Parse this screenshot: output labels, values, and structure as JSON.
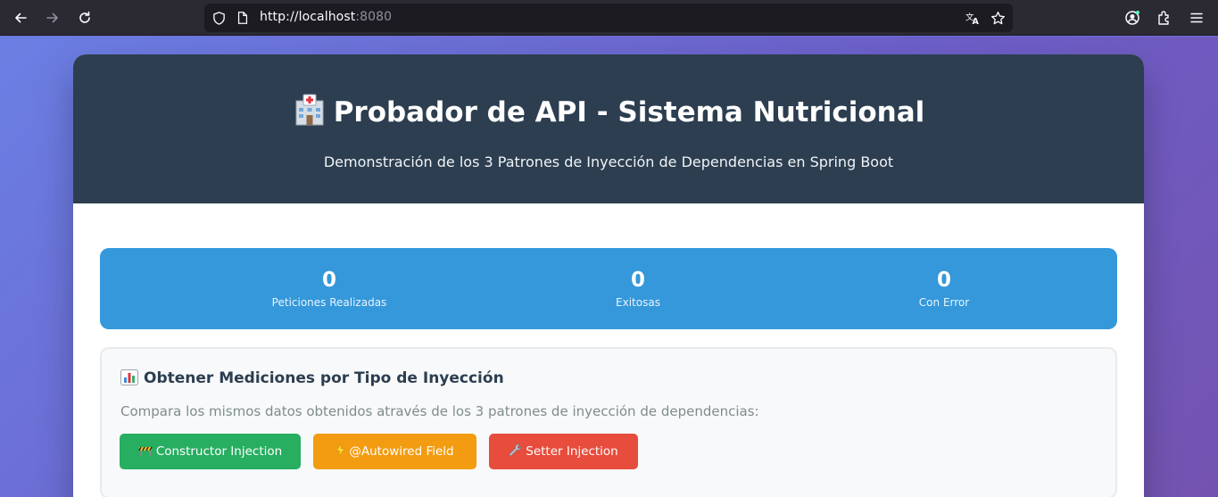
{
  "browser": {
    "url_host": "http://localhost",
    "url_port": ":8080",
    "icons": [
      "back-icon",
      "forward-icon",
      "reload-icon",
      "shield-icon",
      "page-icon",
      "translate-icon",
      "star-icon",
      "account-icon",
      "extensions-icon",
      "menu-icon"
    ]
  },
  "header": {
    "icon": "hospital-icon",
    "title": "Probador de API - Sistema Nutricional",
    "subtitle": "Demonstración de los 3 Patrones de Inyección de Dependencias en Spring Boot"
  },
  "stats": [
    {
      "value": "0",
      "label": "Peticiones Realizadas"
    },
    {
      "value": "0",
      "label": "Exitosas"
    },
    {
      "value": "0",
      "label": "Con Error"
    }
  ],
  "section": {
    "icon": "bar-chart-icon",
    "title": "Obtener Mediciones por Tipo de Inyección",
    "description": "Compara los mismos datos obtenidos através de los 3 patrones de inyección de dependencias:",
    "buttons": [
      {
        "label": "Constructor Injection",
        "icon": "construction-icon",
        "color": "#27ae60"
      },
      {
        "label": "@Autowired Field",
        "icon": "lightning-icon",
        "color": "#f39c12"
      },
      {
        "label": "Setter Injection",
        "icon": "wrench-icon",
        "color": "#e74c3c"
      }
    ]
  },
  "colors": {
    "header_bg": "#2c3e50",
    "stats_bg": "#3498db",
    "accent_gradient_start": "#6b7fe3",
    "accent_gradient_end": "#7453b0"
  }
}
